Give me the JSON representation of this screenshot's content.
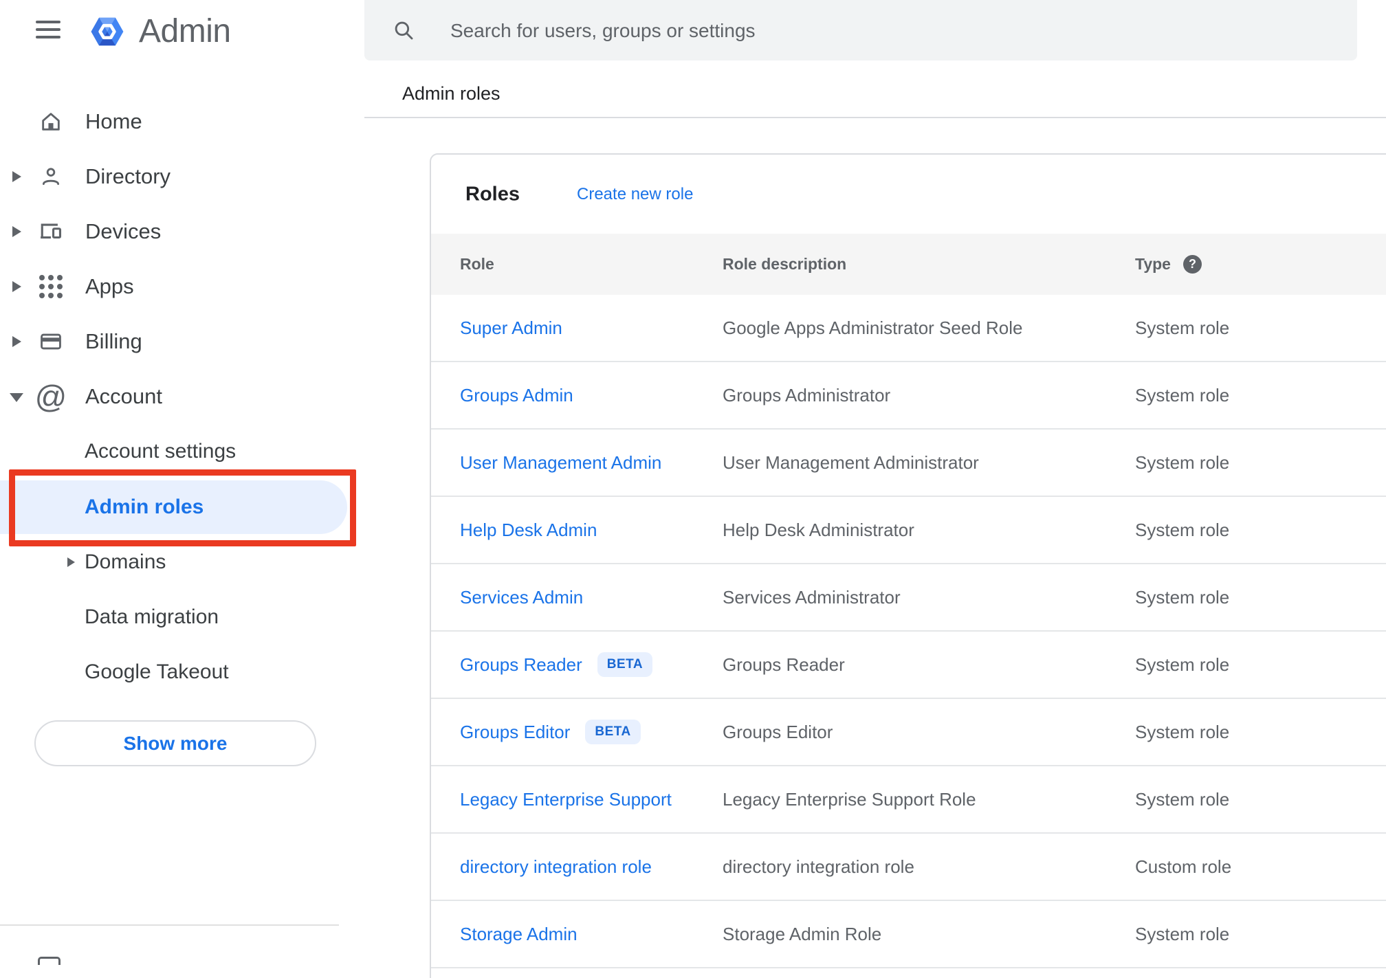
{
  "app": {
    "name": "Admin"
  },
  "topbar": {
    "search_placeholder": "Search for users, groups or settings"
  },
  "breadcrumb": "Admin roles",
  "sidebar": {
    "items": [
      {
        "label": "Home"
      },
      {
        "label": "Directory"
      },
      {
        "label": "Devices"
      },
      {
        "label": "Apps"
      },
      {
        "label": "Billing"
      },
      {
        "label": "Account"
      }
    ],
    "account_children": [
      {
        "label": "Account settings"
      },
      {
        "label": "Admin roles",
        "selected": true
      },
      {
        "label": "Domains"
      },
      {
        "label": "Data migration"
      },
      {
        "label": "Google Takeout"
      }
    ],
    "show_more_label": "Show more"
  },
  "annotation": {
    "type": "red-box",
    "target": "Admin roles sidebar item"
  },
  "roles_panel": {
    "title": "Roles",
    "create_link": "Create new role",
    "columns": {
      "role": "Role",
      "description": "Role description",
      "type": "Type"
    },
    "rows": [
      {
        "role": "Super Admin",
        "description": "Google Apps Administrator Seed Role",
        "type": "System role"
      },
      {
        "role": "Groups Admin",
        "description": "Groups Administrator",
        "type": "System role"
      },
      {
        "role": "User Management Admin",
        "description": "User Management Administrator",
        "type": "System role"
      },
      {
        "role": "Help Desk Admin",
        "description": "Help Desk Administrator",
        "type": "System role"
      },
      {
        "role": "Services Admin",
        "description": "Services Administrator",
        "type": "System role"
      },
      {
        "role": "Groups Reader",
        "badge": "BETA",
        "description": "Groups Reader",
        "type": "System role"
      },
      {
        "role": "Groups Editor",
        "badge": "BETA",
        "description": "Groups Editor",
        "type": "System role"
      },
      {
        "role": "Legacy Enterprise Support",
        "description": "Legacy Enterprise Support Role",
        "type": "System role"
      },
      {
        "role": "directory integration role",
        "description": "directory integration role",
        "type": "Custom role"
      },
      {
        "role": "Storage Admin",
        "description": "Storage Admin Role",
        "type": "System role"
      }
    ]
  },
  "icons": {
    "at_glyph": "@",
    "help_glyph": "?"
  },
  "colors": {
    "accent_blue": "#1a73e8",
    "selected_bg": "#e8f0fe",
    "beta_text": "#1967d2",
    "annotation_red": "#ea3a21",
    "table_header_bg": "#f5f5f5",
    "divider": "#e0e0e0",
    "text_primary": "#202124",
    "text_secondary": "#5f6368"
  }
}
